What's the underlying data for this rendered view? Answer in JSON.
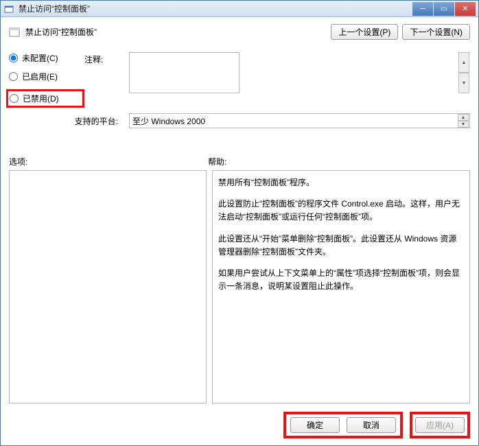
{
  "window": {
    "title": "禁止访问“控制面板”"
  },
  "header": {
    "title": "禁止访问“控制面板”",
    "prev": "上一个设置(P)",
    "next": "下一个设置(N)"
  },
  "radios": {
    "not_configured": "未配置(C)",
    "enabled": "已启用(E)",
    "disabled": "已禁用(D)"
  },
  "comment": {
    "label": "注释:",
    "value": ""
  },
  "platform": {
    "label": "支持的平台:",
    "value": "至少 Windows 2000"
  },
  "panels": {
    "options_label": "选项:",
    "help_label": "帮助:"
  },
  "help": {
    "p1": "禁用所有“控制面板”程序。",
    "p2": "此设置防止“控制面板”的程序文件 Control.exe 启动。这样，用户无法启动“控制面板”或运行任何“控制面板”项。",
    "p3": "此设置还从“开始”菜单删除“控制面板”。此设置还从 Windows 资源管理器删除“控制面板”文件夹。",
    "p4": "如果用户尝试从上下文菜单上的“属性”项选择“控制面板”项，则会显示一条消息，说明某设置阻止此操作。"
  },
  "footer": {
    "ok": "确定",
    "cancel": "取消",
    "apply": "应用(A)"
  }
}
